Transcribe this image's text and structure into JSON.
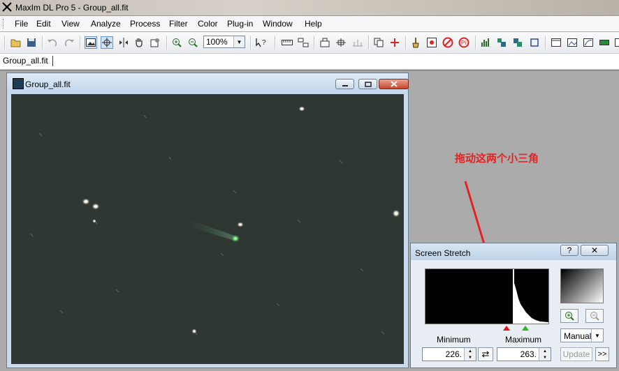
{
  "app": {
    "title": "MaxIm DL Pro 5 - Group_all.fit"
  },
  "menu": {
    "items": [
      "File",
      "Edit",
      "View",
      "Analyze",
      "Process",
      "Filter",
      "Color",
      "Plug-in",
      "Window",
      "Help"
    ]
  },
  "toolbar": {
    "zoom_value": "100%"
  },
  "tabs": {
    "doc_tab": "Group_all.fit"
  },
  "image_window": {
    "title": "Group_all.fit"
  },
  "annotation": {
    "text": "拖动这两个小三角"
  },
  "screen_stretch": {
    "title": "Screen Stretch",
    "help_label": "?",
    "close_label": "✕",
    "minimum_label": "Minimum",
    "maximum_label": "Maximum",
    "minimum_value": "226.",
    "maximum_value": "263.",
    "mode_value": "Manual",
    "update_label": "Update",
    "more_label": ">>"
  },
  "colors": {
    "annotation": "#e52222",
    "image_background": "#2c3530",
    "window_caption": "#c2d6eb"
  },
  "icons": [
    "open-icon",
    "save-icon",
    "undo-icon",
    "redo-icon",
    "image-view-icon",
    "crosshair-icon",
    "zoom-in-icon",
    "zoom-out-icon",
    "help-pointer-icon"
  ]
}
